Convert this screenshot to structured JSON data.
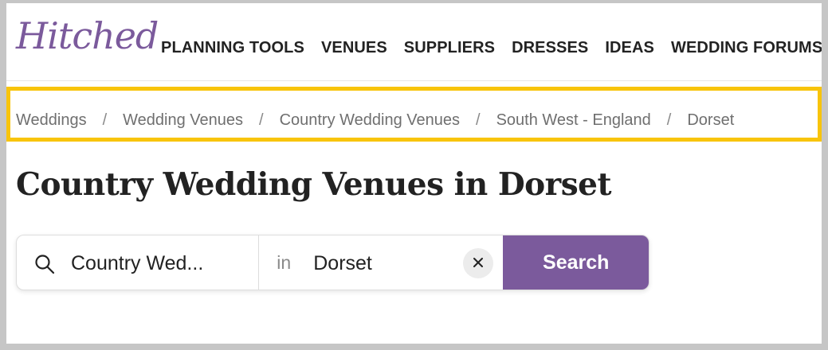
{
  "header": {
    "logo_text": "Hitched",
    "brand_color": "#7b5a9c",
    "nav": [
      {
        "label": "PLANNING TOOLS"
      },
      {
        "label": "VENUES"
      },
      {
        "label": "SUPPLIERS"
      },
      {
        "label": "DRESSES"
      },
      {
        "label": "IDEAS"
      },
      {
        "label": "WEDDING FORUMS"
      }
    ]
  },
  "breadcrumb": {
    "highlight_color": "#f8c40c",
    "separator": "/",
    "items": [
      {
        "label": "Weddings"
      },
      {
        "label": "Wedding Venues"
      },
      {
        "label": "Country Wedding Venues"
      },
      {
        "label": "South West - England"
      },
      {
        "label": "Dorset"
      }
    ]
  },
  "main": {
    "title": "Country Wedding Venues in Dorset"
  },
  "search": {
    "query_value": "Country Wed...",
    "in_label": "in",
    "location_value": "Dorset",
    "button_label": "Search",
    "icons": {
      "search": "search-icon",
      "clear": "close-icon"
    }
  }
}
